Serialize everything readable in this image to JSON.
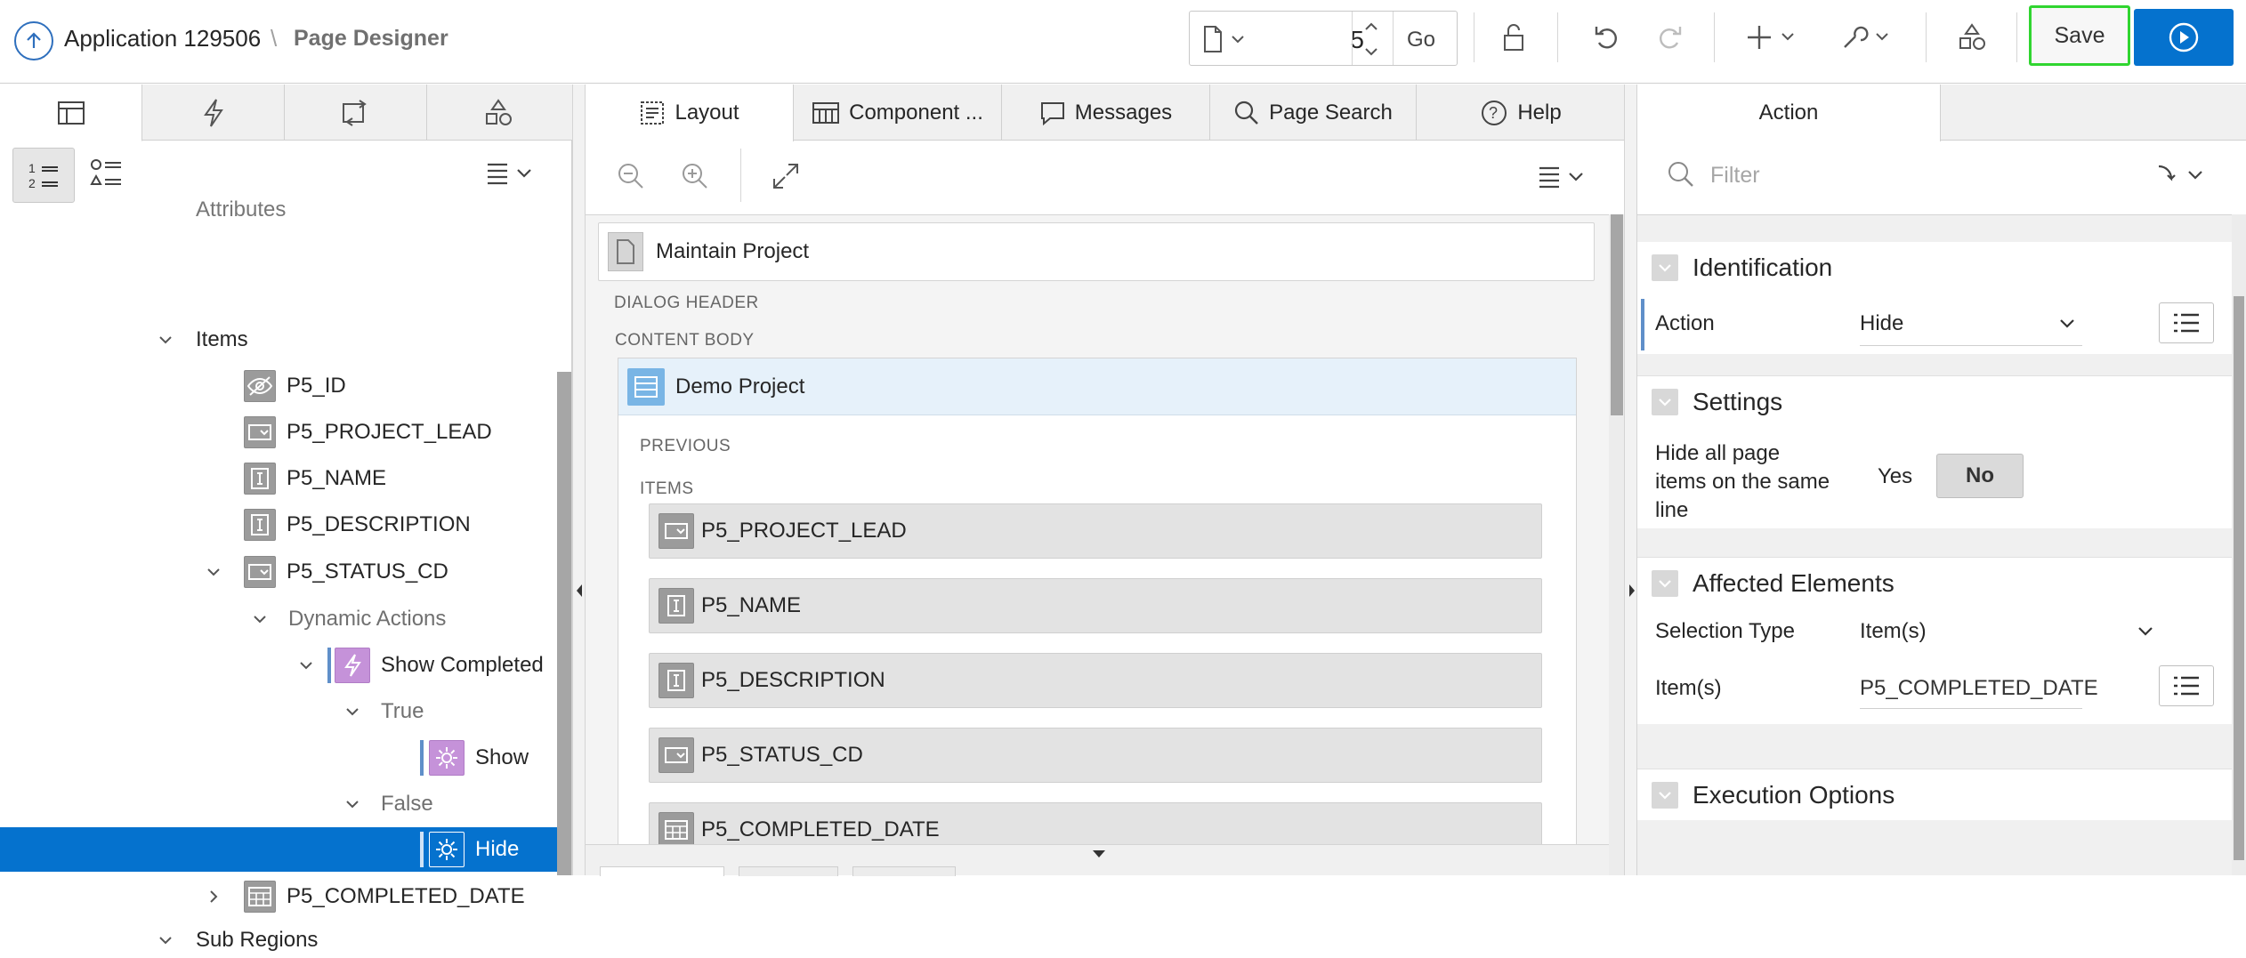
{
  "header": {
    "app_title": "Application 129506",
    "separator": "\\",
    "page_designer": "Page Designer",
    "page_number": "5",
    "go_label": "Go",
    "save_label": "Save"
  },
  "left_tabs": [
    "rendering-icon",
    "dynamic-actions-icon",
    "processing-icon",
    "shared-components-icon"
  ],
  "tree": {
    "attributes_label": "Attributes",
    "items_label": "Items",
    "p5_id": "P5_ID",
    "p5_project_lead": "P5_PROJECT_LEAD",
    "p5_name": "P5_NAME",
    "p5_description": "P5_DESCRIPTION",
    "p5_status_cd": "P5_STATUS_CD",
    "dynamic_actions": "Dynamic Actions",
    "show_completed": "Show Completed",
    "true_label": "True",
    "show_label": "Show",
    "false_label": "False",
    "hide_label": "Hide",
    "p5_completed_date": "P5_COMPLETED_DATE",
    "sub_regions": "Sub Regions"
  },
  "center_tabs": {
    "layout": "Layout",
    "component": "Component ...",
    "messages": "Messages",
    "page_search": "Page Search",
    "help": "Help"
  },
  "layout": {
    "page_title": "Maintain Project",
    "dialog_header": "DIALOG HEADER",
    "content_body": "CONTENT BODY",
    "region_title": "Demo Project",
    "previous": "PREVIOUS",
    "items": "ITEMS",
    "item_bars": [
      "P5_PROJECT_LEAD",
      "P5_NAME",
      "P5_DESCRIPTION",
      "P5_STATUS_CD",
      "P5_COMPLETED_DATE"
    ]
  },
  "properties": {
    "tab_label": "Action",
    "filter_placeholder": "Filter",
    "identification": "Identification",
    "action_label": "Action",
    "action_value": "Hide",
    "settings": "Settings",
    "hide_all_label_1": "Hide all page",
    "hide_all_label_2": "items on the same",
    "hide_all_label_3": "line",
    "yes_label": "Yes",
    "no_label": "No",
    "affected_elements": "Affected Elements",
    "selection_type_label": "Selection Type",
    "selection_type_value": "Item(s)",
    "items_label": "Item(s)",
    "items_value": "P5_COMPLETED_DATE",
    "execution_options": "Execution Options"
  },
  "colors": {
    "accent_blue": "#0572ce",
    "highlight_green": "#30d530",
    "dynamic_action_purple": "#c592d9",
    "region_blue": "#79b5e5"
  }
}
